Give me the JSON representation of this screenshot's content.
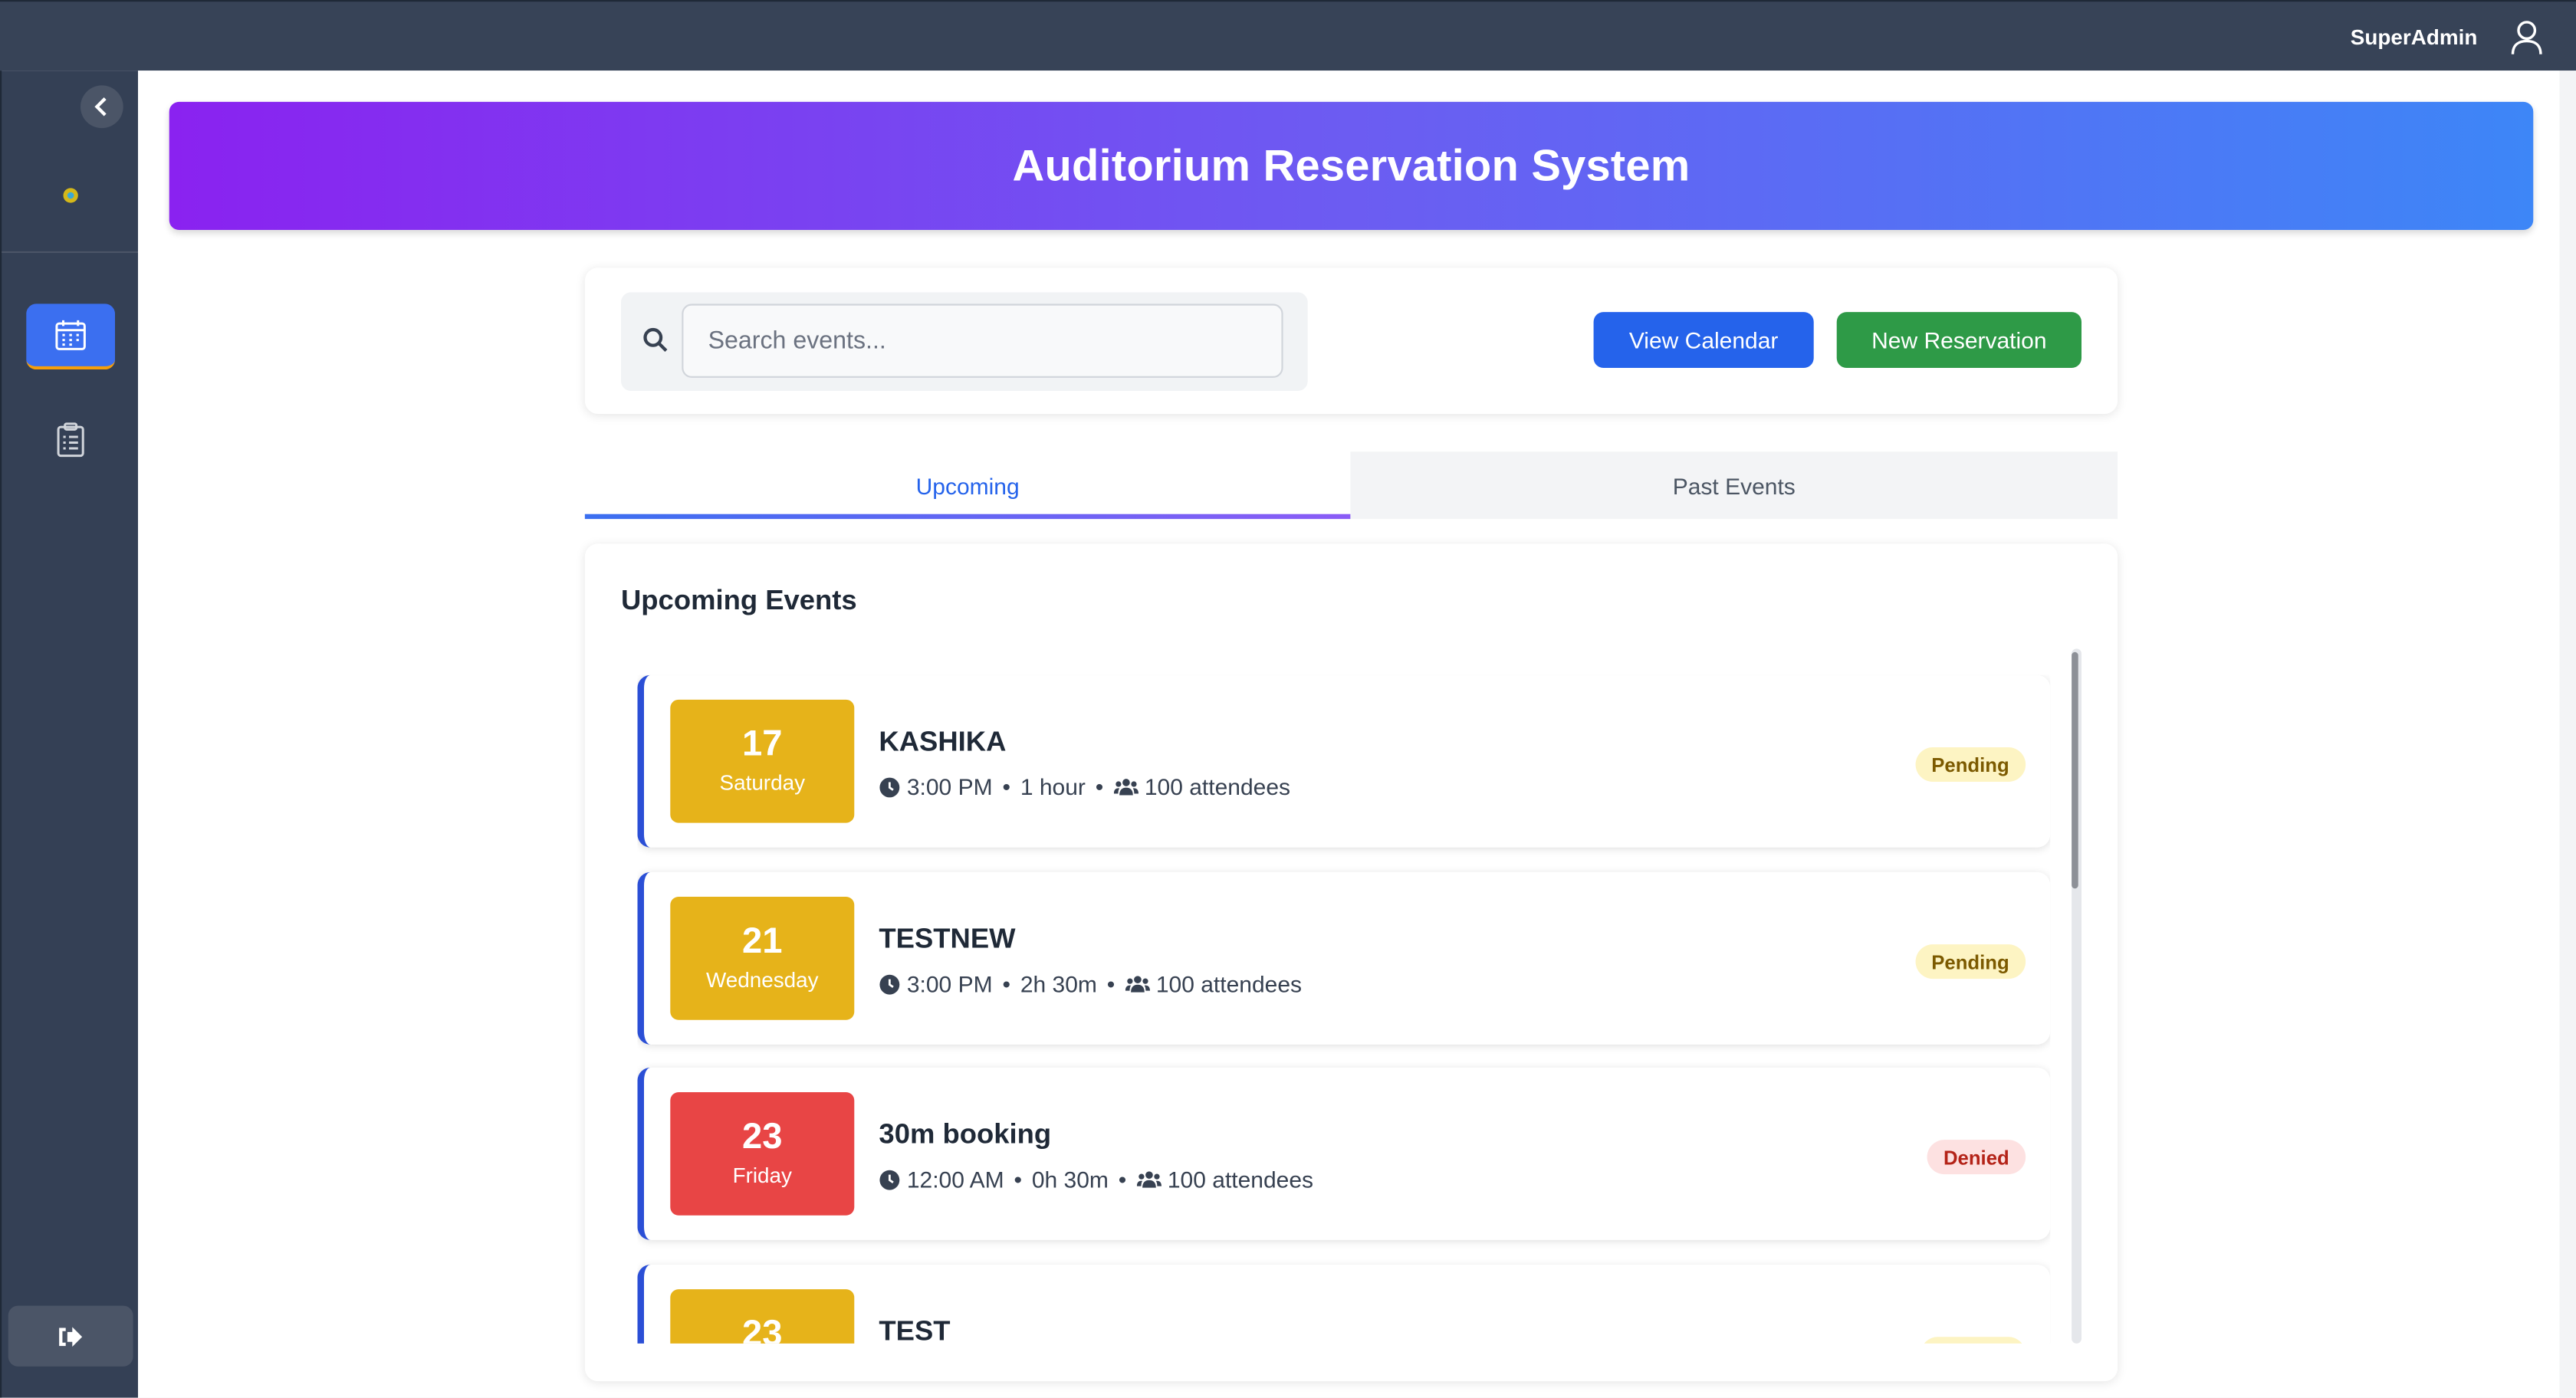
{
  "topbar": {
    "user_name": "SuperAdmin",
    "user_icon": "user-icon"
  },
  "sidebar": {
    "collapse_icon": "chevron-left-icon",
    "logo_icon": "gear-icon",
    "items": [
      {
        "icon": "calendar-icon",
        "active": true
      },
      {
        "icon": "clipboard-list-icon",
        "active": false
      }
    ],
    "logout_icon": "logout-icon"
  },
  "hero": {
    "title": "Auditorium Reservation System"
  },
  "toolbar": {
    "search_placeholder": "Search events...",
    "search_value": "",
    "view_calendar_label": "View Calendar",
    "new_reservation_label": "New Reservation"
  },
  "tabs": [
    {
      "label": "Upcoming",
      "active": true
    },
    {
      "label": "Past Events",
      "active": false
    }
  ],
  "events_section": {
    "title": "Upcoming Events",
    "events": [
      {
        "day": "17",
        "weekday": "Saturday",
        "title": "KASHIKA",
        "time": "3:00 PM",
        "duration": "1 hour",
        "attendees": "100 attendees",
        "status": "Pending",
        "color": "#e6b31a"
      },
      {
        "day": "21",
        "weekday": "Wednesday",
        "title": "TESTNEW",
        "time": "3:00 PM",
        "duration": "2h 30m",
        "attendees": "100 attendees",
        "status": "Pending",
        "color": "#e6b31a"
      },
      {
        "day": "23",
        "weekday": "Friday",
        "title": "30m booking",
        "time": "12:00 AM",
        "duration": "0h 30m",
        "attendees": "100 attendees",
        "status": "Denied",
        "color": "#e84545"
      },
      {
        "day": "23",
        "weekday": "",
        "title": "TEST",
        "time": "",
        "duration": "",
        "attendees": "",
        "status": "",
        "color": "#e6b31a"
      }
    ]
  },
  "colors": {
    "topbar": "#374357",
    "sidebar": "#344055",
    "primary": "#2563eb",
    "success": "#2e9a47",
    "pending_bg": "#fdf4c3",
    "denied_bg": "#fde1e1"
  }
}
